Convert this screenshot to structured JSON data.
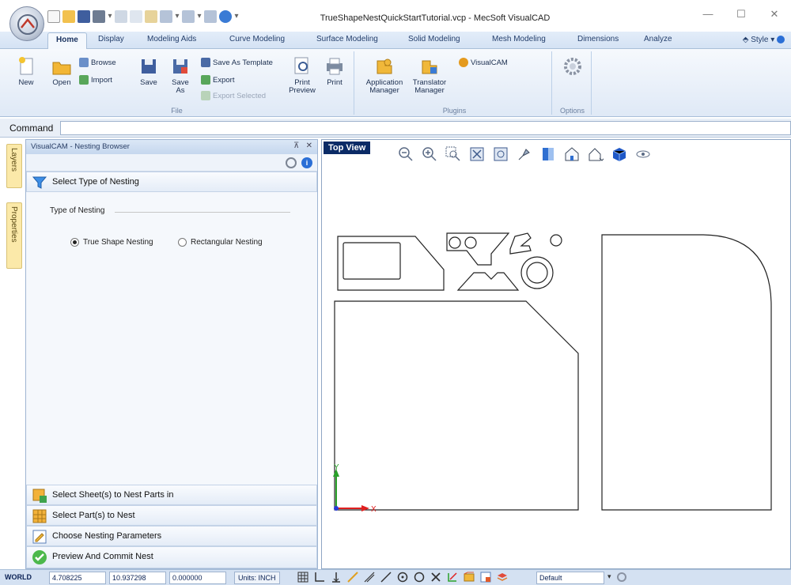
{
  "window": {
    "title": "TrueShapeNestQuickStartTutorial.vcp - MecSoft VisualCAD",
    "minimize": "—",
    "maximize": "☐",
    "close": "✕"
  },
  "ribbon_tabs": [
    "Home",
    "Display",
    "Modeling Aids",
    "Curve Modeling",
    "Surface Modeling",
    "Solid Modeling",
    "Mesh Modeling",
    "Dimensions",
    "Analyze"
  ],
  "style_menu": "Style",
  "ribbon": {
    "file": {
      "label": "File",
      "new": "New",
      "open": "Open",
      "browse": "Browse",
      "import": "Import",
      "save": "Save",
      "save_as_1": "Save",
      "save_as_2": "As",
      "save_as_template": "Save As Template",
      "export": "Export",
      "export_selected": "Export Selected",
      "print_preview_1": "Print",
      "print_preview_2": "Preview",
      "print": "Print"
    },
    "plugins": {
      "label": "Plugins",
      "app_manager_1": "Application",
      "app_manager_2": "Manager",
      "translator_manager_1": "Translator",
      "translator_manager_2": "Manager",
      "visualcam": "VisualCAM"
    },
    "options": {
      "label": "Options"
    }
  },
  "command": {
    "label": "Command",
    "value": ""
  },
  "side_tabs": [
    "Layers",
    "Properties"
  ],
  "nesting_browser": {
    "title": "VisualCAM - Nesting Browser",
    "pin": "⊼",
    "close": "✕",
    "info": "i",
    "select_type": "Select Type of Nesting",
    "type_label": "Type of Nesting",
    "true_shape": "True Shape Nesting",
    "rectangular": "Rectangular Nesting",
    "selected_type": "True Shape Nesting",
    "steps": [
      "Select Sheet(s) to Nest Parts in",
      "Select Part(s) to Nest",
      "Choose Nesting Parameters",
      "Preview And Commit Nest"
    ]
  },
  "viewport": {
    "label": "Top View",
    "axis_x": "X",
    "axis_y": "Y"
  },
  "statusbar": {
    "world": "WORLD",
    "x": "4.708225",
    "y": "10.937298",
    "z": "0.000000",
    "units": "Units: INCH",
    "layer": "Default"
  },
  "colors": {
    "ribbon_tab_text": "#233e6b",
    "view_label_bg": "#0b2b66",
    "side_tab_bg": "#fbe9a9",
    "axis_x": "#e02020",
    "axis_y": "#2aa12a",
    "axis_origin": "#2a3bd6"
  }
}
